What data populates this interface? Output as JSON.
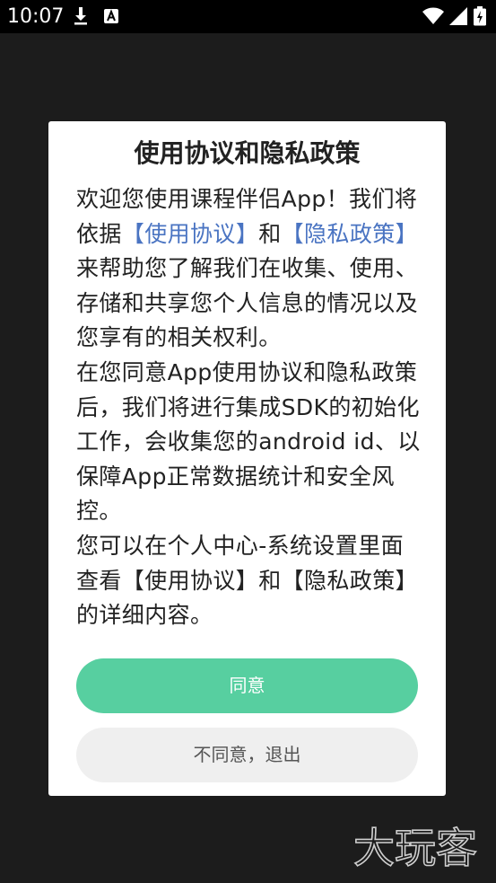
{
  "status_bar": {
    "time": "10:07",
    "icons": [
      "download-icon",
      "a-icon",
      "wifi-icon",
      "signal-icon",
      "battery-icon"
    ]
  },
  "dialog": {
    "title": "使用协议和隐私政策",
    "paragraph1": {
      "part1": "欢迎您使用课程伴侣App！我们将依据",
      "link1": "【使用协议】",
      "part2": "和",
      "link2": "【隐私政策】",
      "part3": "来帮助您了解我们在收集、使用、存储和共享您个人信息的情况以及您享有的相关权利。"
    },
    "paragraph2": "在您同意App使用协议和隐私政策后，我们将进行集成SDK的初始化工作，会收集您的android id、以保障App正常数据统计和安全风控。",
    "paragraph3": "您可以在个人中心-系统设置里面查看【使用协议】和【隐私政策】的详细内容。",
    "agree_label": "同意",
    "disagree_label": "不同意，退出"
  },
  "watermark": {
    "text": "大玩客"
  },
  "colors": {
    "accent": "#57cfa0",
    "link": "#4a74c2",
    "secondary_button": "#efefef",
    "status_bar": "#000000",
    "backdrop": "#1c1c1c"
  }
}
